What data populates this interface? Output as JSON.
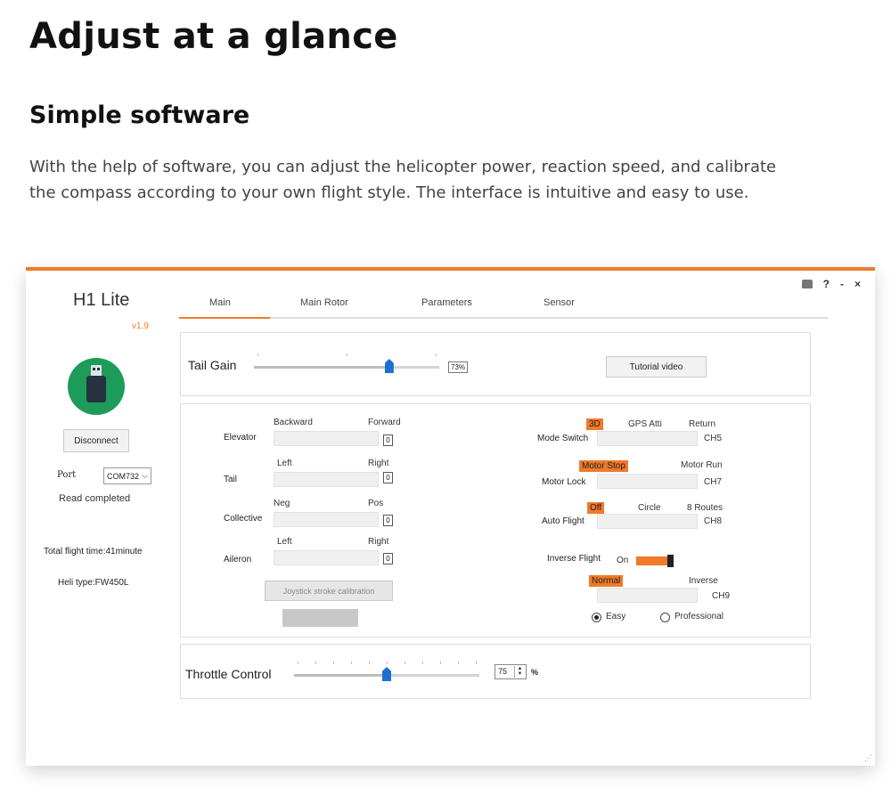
{
  "hero": {
    "title": "Adjust at a glance",
    "subtitle": "Simple software",
    "description": "With the help of  software, you can adjust the helicopter power, reaction speed, and calibrate the compass according to your own flight style. The interface is intuitive and easy to use."
  },
  "window": {
    "controls": {
      "help": "?",
      "minimize": "-",
      "close": "×"
    },
    "resize_grip": "⋰"
  },
  "sidebar": {
    "app_name": "H1 Lite",
    "version": "v1.9",
    "disconnect_label": "Disconnect",
    "port_label": "Port",
    "port_value": "COM732",
    "status": "Read completed",
    "total_flight_time": "Total flight time:41minute",
    "heli_type": "Heli type:FW450L"
  },
  "tabs": [
    {
      "label": "Main",
      "active": true
    },
    {
      "label": "Main Rotor",
      "active": false
    },
    {
      "label": "Parameters",
      "active": false
    },
    {
      "label": "Sensor",
      "active": false
    }
  ],
  "tail_gain": {
    "label": "Tail Gain",
    "value": "73%",
    "slider_fraction": 0.73,
    "tutorial_label": "Tutorial video"
  },
  "sticks": [
    {
      "label": "Elevator",
      "left": "Backward",
      "right": "Forward",
      "value": "0"
    },
    {
      "label": "Tail",
      "left": "Left",
      "right": "Right",
      "value": "0"
    },
    {
      "label": "Collective",
      "left": "Neg",
      "right": "Pos",
      "value": "0"
    },
    {
      "label": "Aileron",
      "left": "Left",
      "right": "Right",
      "value": "0"
    }
  ],
  "calibration_label": "Joystick stroke calibration",
  "switches": {
    "mode_switch": {
      "label": "Mode Switch",
      "options": [
        "3D",
        "GPS Atti",
        "Return"
      ],
      "channel": "CH5"
    },
    "motor_lock": {
      "label": "Motor Lock",
      "options": [
        "Motor Stop",
        "Motor Run"
      ],
      "channel": "CH7"
    },
    "auto_flight": {
      "label": "Auto Flight",
      "options": [
        "Off",
        "Circle",
        "8 Routes"
      ],
      "channel": "CH8"
    },
    "inverse_flight": {
      "label": "Inverse Flight",
      "state": "On"
    },
    "inverse_mode": {
      "options": [
        "Normal",
        "Inverse"
      ],
      "channel": "CH9"
    }
  },
  "difficulty": {
    "easy": "Easy",
    "professional": "Professional",
    "selected": "Easy"
  },
  "throttle": {
    "label": "Throttle Control",
    "value": "75",
    "unit": "%",
    "slider_fraction": 0.5
  },
  "colors": {
    "accent": "#ef7a2a",
    "usb_green": "#1d9b59",
    "thumb_blue": "#1a6fd1"
  }
}
